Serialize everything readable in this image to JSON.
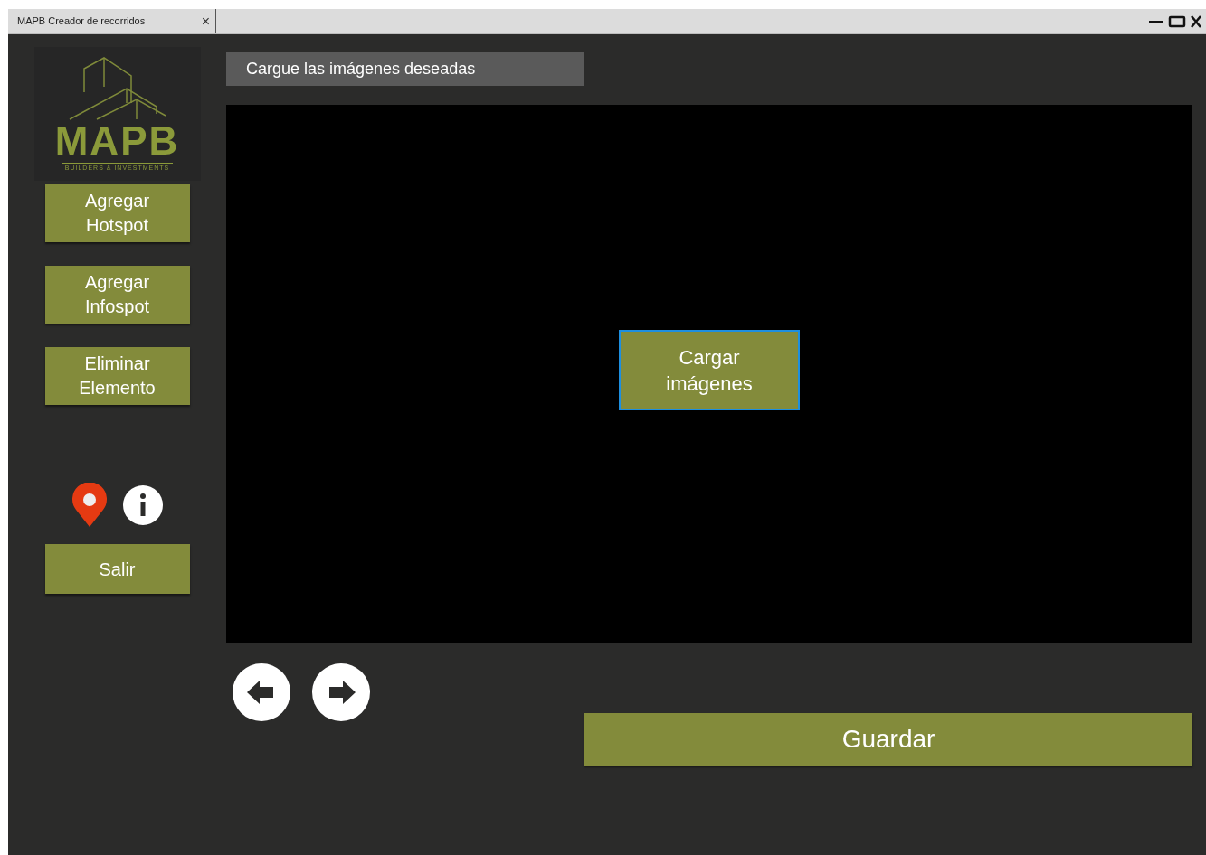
{
  "window": {
    "tab_title": "MAPB Creador de recorridos",
    "tab_close": "×"
  },
  "logo": {
    "name": "MAPB",
    "tagline": "BUILDERS & INVESTMENTS"
  },
  "sidebar": {
    "buttons": [
      {
        "label": "Agregar Hotspot"
      },
      {
        "label": "Agregar Infospot"
      },
      {
        "label": "Eliminar Elemento"
      }
    ],
    "exit_button": "Salir"
  },
  "header": "Cargue las imágenes deseadas",
  "viewer": {
    "load_button": "Cargar imágenes"
  },
  "save_button": "Guardar"
}
